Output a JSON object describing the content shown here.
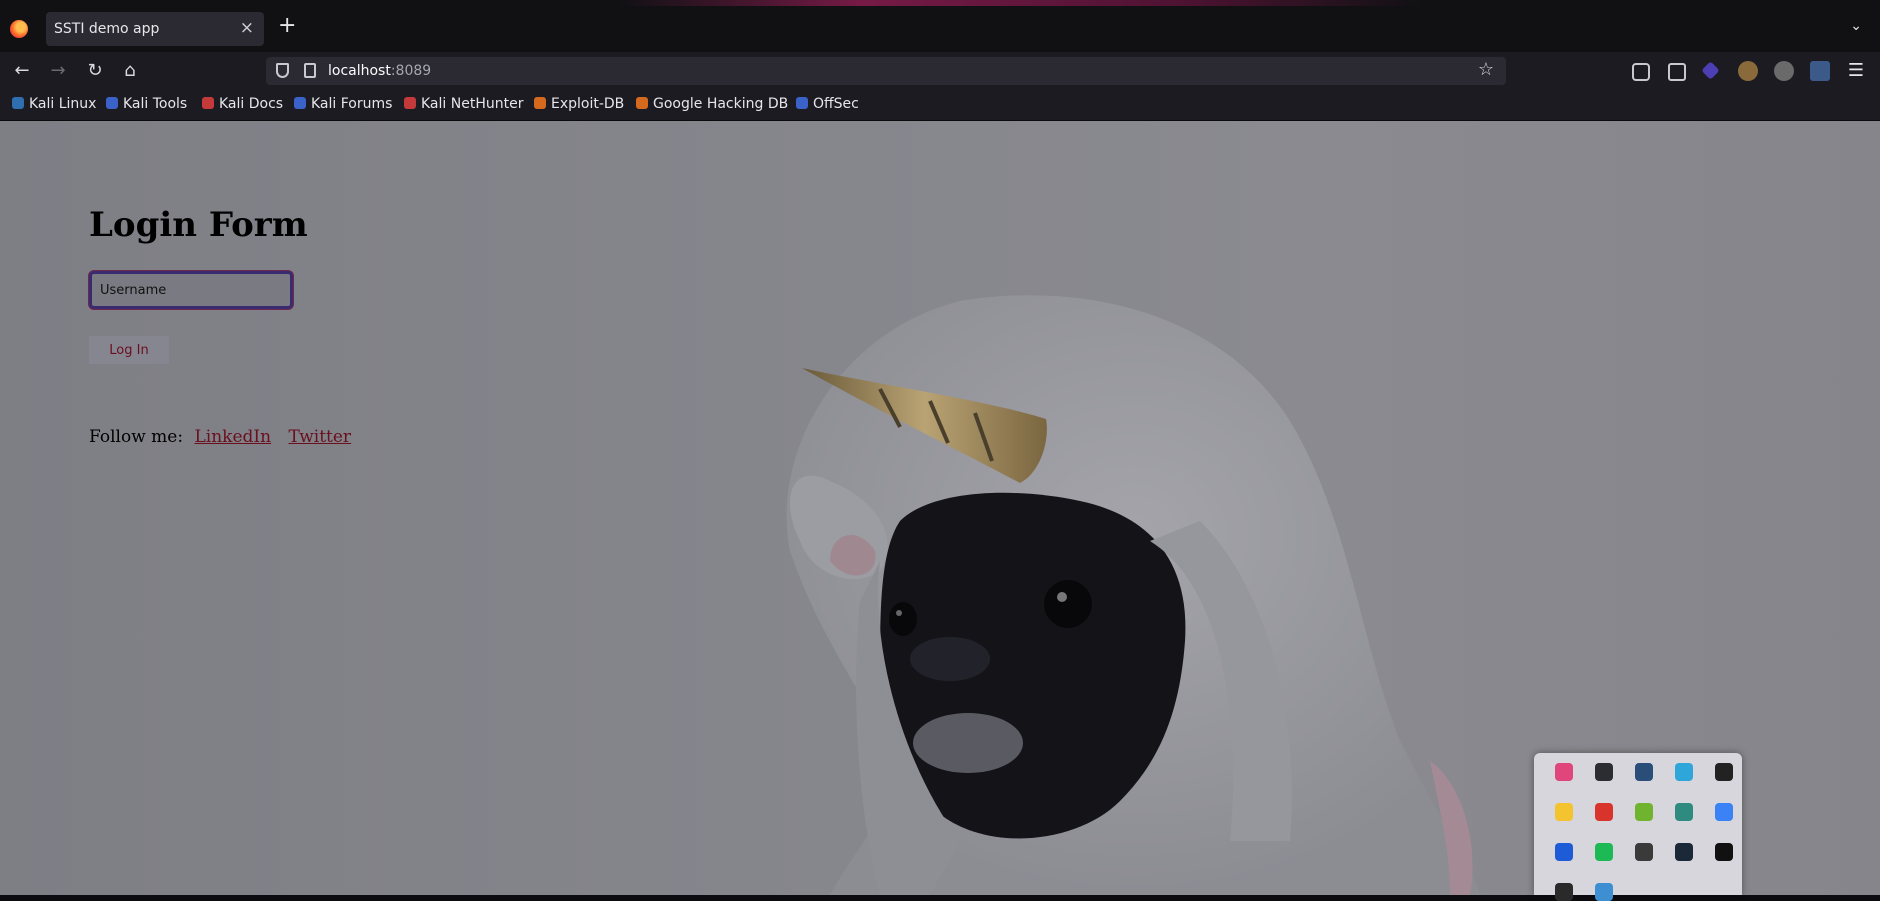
{
  "browser": {
    "tab_title": "SSTI demo app",
    "close_glyph": "×",
    "new_tab_glyph": "+",
    "url_host": "localhost",
    "url_port": ":8089",
    "bookmarks": [
      "Kali Linux",
      "Kali Tools",
      "Kali Docs",
      "Kali Forums",
      "Kali NetHunter",
      "Exploit-DB",
      "Google Hacking DB",
      "OffSec"
    ],
    "bookmark_icon_colors": [
      "#2f6fb0",
      "#3b62c8",
      "#c43a3a",
      "#3b62c8",
      "#c43a3a",
      "#d56a1f",
      "#d56a1f",
      "#3b62c8"
    ]
  },
  "page": {
    "title": "Login Form",
    "username_value": "Username",
    "login_label": "Log In",
    "follow_label": "Follow me:",
    "links": [
      "LinkedIn",
      "Twitter"
    ]
  },
  "tray": {
    "icons": [
      {
        "name": "firefox-icon",
        "color": "#e0457b"
      },
      {
        "name": "discord-icon",
        "color": "#2b2d31"
      },
      {
        "name": "hexagon-app-icon",
        "color": "#2a4d7a"
      },
      {
        "name": "telegram-icon",
        "color": "#2ea6da"
      },
      {
        "name": "epic-games-icon",
        "color": "#222"
      },
      {
        "name": "sun-app-icon",
        "color": "#f4c430"
      },
      {
        "name": "color-wheel-icon",
        "color": "#d9342b"
      },
      {
        "name": "utorrent-icon",
        "color": "#6fb32e"
      },
      {
        "name": "network-app-icon",
        "color": "#2f8a80"
      },
      {
        "name": "drop-icon",
        "color": "#3b82f6"
      },
      {
        "name": "remote-desktop-icon",
        "color": "#1e5bd6"
      },
      {
        "name": "spotify-icon",
        "color": "#1db954"
      },
      {
        "name": "copy-app-icon",
        "color": "#3a3a3a"
      },
      {
        "name": "steam-icon",
        "color": "#1b2838"
      },
      {
        "name": "b-app-icon",
        "color": "#111"
      },
      {
        "name": "gear-app-icon",
        "color": "#2a2a2a"
      },
      {
        "name": "cube-app-icon",
        "color": "#3d8fd1"
      }
    ]
  }
}
